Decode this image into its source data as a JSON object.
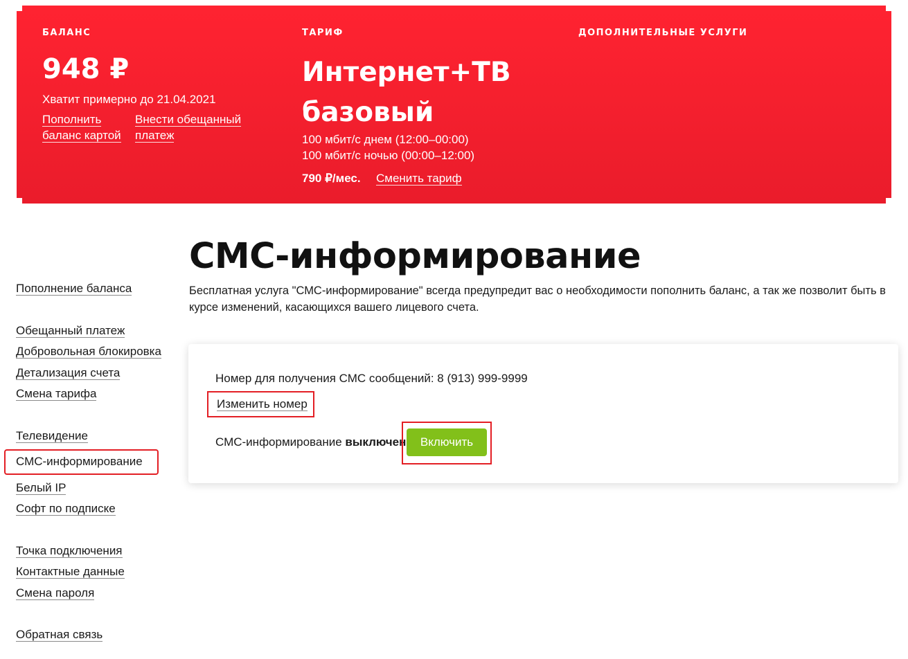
{
  "banner": {
    "balance": {
      "caption": "БАЛАНС",
      "amount": "948 ₽",
      "note": "Хватит примерно до 21.04.2021",
      "topup_link": "Пополнить баланс картой",
      "promise_link": "Внести обещанный платеж"
    },
    "tariff": {
      "caption": "ТАРИФ",
      "name": "Интернет+ТВ базовый",
      "speed_day": "100 мбит/с днем (12:00–00:00)",
      "speed_night": "100 мбит/с ночью (00:00–12:00)",
      "price": "790 ₽/мес.",
      "change_link": "Сменить тариф"
    },
    "extra": {
      "caption": "ДОПОЛНИТЕЛЬНЫЕ УСЛУГИ"
    }
  },
  "sidebar": {
    "items": [
      {
        "label": "Пополнение баланса"
      },
      {
        "label": "Обещанный платеж"
      },
      {
        "label": "Добровольная блокировка"
      },
      {
        "label": "Детализация счета"
      },
      {
        "label": "Смена тарифа"
      },
      {
        "label": "Телевидение"
      },
      {
        "label": "СМС-информирование"
      },
      {
        "label": "Белый IP"
      },
      {
        "label": "Софт по подписке"
      },
      {
        "label": "Точка подключения"
      },
      {
        "label": "Контактные данные"
      },
      {
        "label": "Смена пароля"
      },
      {
        "label": "Обратная связь"
      }
    ]
  },
  "main": {
    "title": "СМС-информирование",
    "description": "Бесплатная услуга \"СМС-информирование\" всегда предупредит вас о необходимости пополнить баланс, а так же позволит быть в курсе изменений, касающихся вашего лицевого счета.",
    "card": {
      "phone_text": "Номер для получения СМС сообщений: 8 (913) 999-9999",
      "change_number_link": "Изменить номер",
      "state_prefix": "СМС-информирование ",
      "state_value": "выключено",
      "enable_button": "Включить"
    }
  },
  "colors": {
    "banner_red": "#ff2331",
    "highlight_red": "#e31e24",
    "enable_green": "#82c01a"
  }
}
